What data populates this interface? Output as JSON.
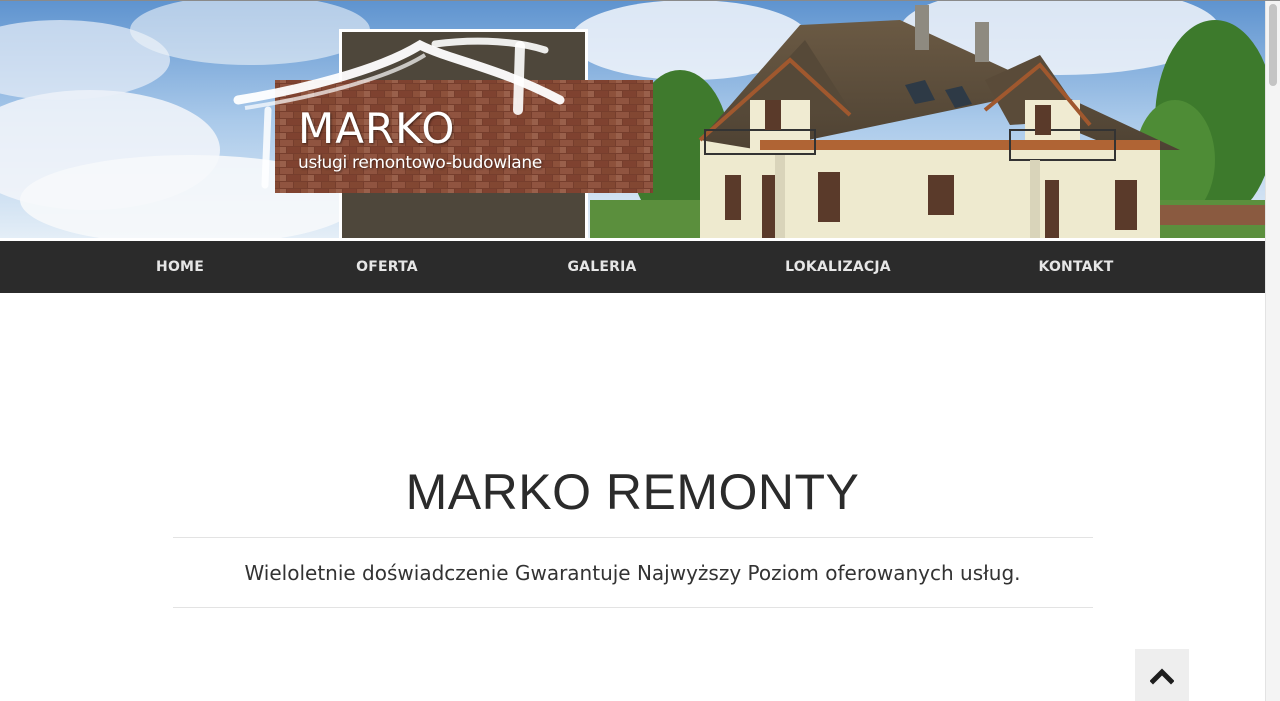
{
  "logo": {
    "name": "MARKO",
    "tagline": "usługi remontowo-budowlane"
  },
  "nav": {
    "items": [
      {
        "label": "HOME"
      },
      {
        "label": "OFERTA"
      },
      {
        "label": "GALERIA"
      },
      {
        "label": "LOKALIZACJA"
      },
      {
        "label": "KONTAKT"
      }
    ]
  },
  "main": {
    "title": "MARKO REMONTY",
    "subtitle": "Wieloletnie doświadczenie Gwarantuje Najwyższy Poziom oferowanych usług."
  },
  "back_to_top": {
    "icon": "chevron-up-icon"
  },
  "colors": {
    "nav_background": "#2b2b2b",
    "nav_text": "#e6e6e6",
    "title_text": "#2b2b2b",
    "logo_panel": "#4e473b",
    "brick": "#8a4a34"
  }
}
